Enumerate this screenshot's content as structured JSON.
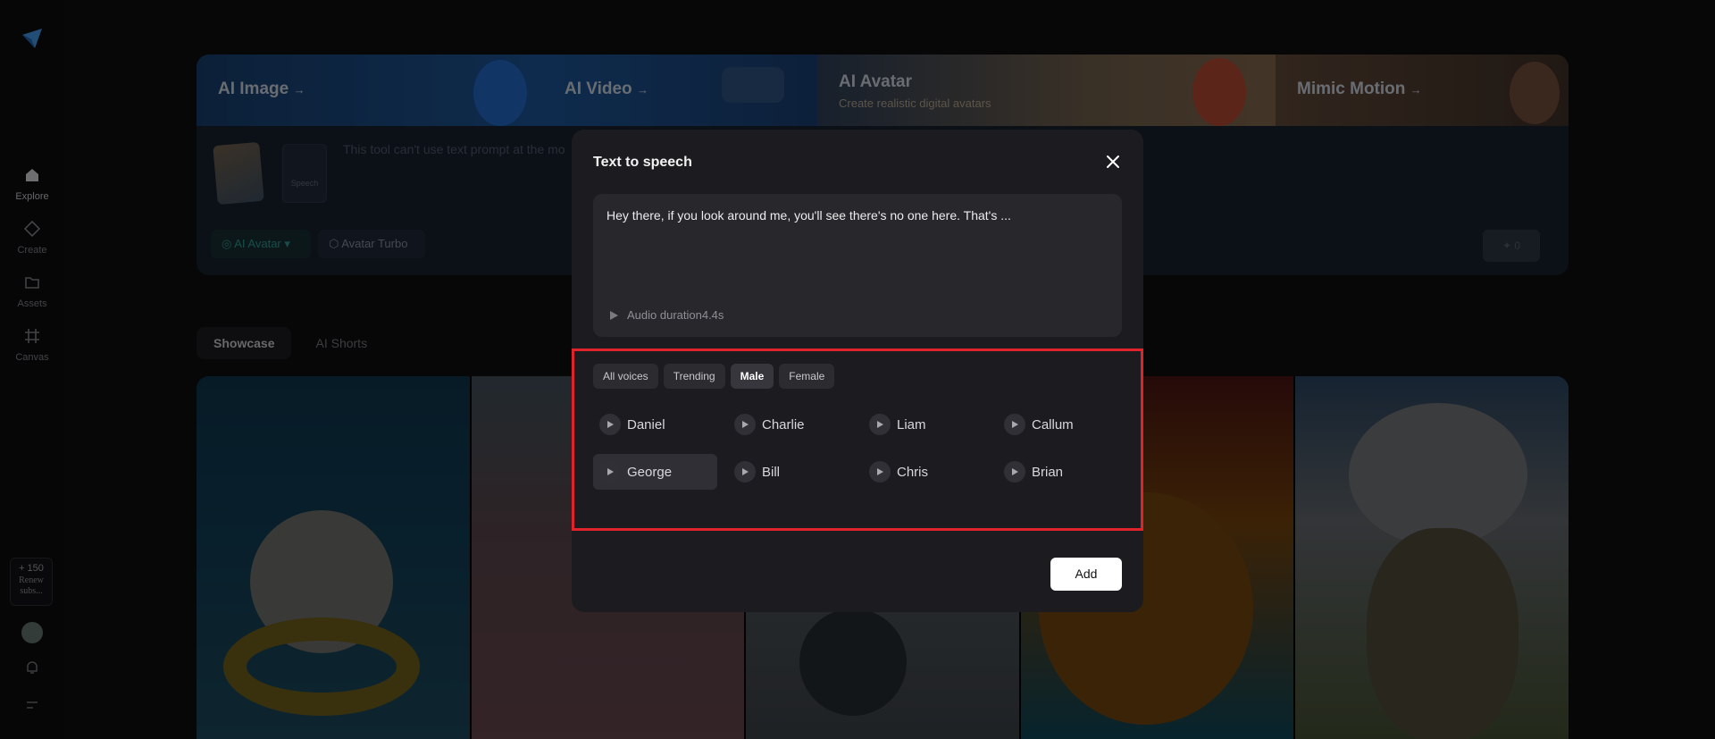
{
  "nav": {
    "items": [
      {
        "label": "Explore"
      },
      {
        "label": "Create"
      },
      {
        "label": "Assets"
      },
      {
        "label": "Canvas"
      }
    ],
    "credits": {
      "amount": "+ 150",
      "renew": "Renew subs..."
    }
  },
  "banner": {
    "items": [
      {
        "title": "AI Image",
        "arrow": "→"
      },
      {
        "title": "AI Video",
        "arrow": "→"
      },
      {
        "title": "AI Avatar",
        "subtitle": "Create realistic digital avatars"
      },
      {
        "title": "Mimic Motion",
        "arrow": "→"
      }
    ]
  },
  "prompt": {
    "thumb_label": "Speech",
    "placeholder": "This tool can't use text prompt at the mo",
    "chip_avatar": "AI Avatar",
    "chip_turbo": "Avatar Turbo",
    "generate_count": "0"
  },
  "page_tabs": [
    {
      "label": "Showcase"
    },
    {
      "label": "AI Shorts"
    }
  ],
  "modal": {
    "title": "Text to speech",
    "script_text": "Hey there, if you look around me, you'll see there's no one here. That's ...",
    "audio_label": "Audio duration4.4s",
    "filters": [
      "All voices",
      "Trending",
      "Male",
      "Female"
    ],
    "active_filter": "Male",
    "voices": [
      "Daniel",
      "Charlie",
      "Liam",
      "Callum",
      "George",
      "Bill",
      "Chris",
      "Brian"
    ],
    "selected_voice": "George",
    "add_label": "Add"
  },
  "colors": {
    "highlight_border": "#e0232b",
    "modal_bg": "#1c1c20",
    "accent_teal": "#2c8f86"
  }
}
